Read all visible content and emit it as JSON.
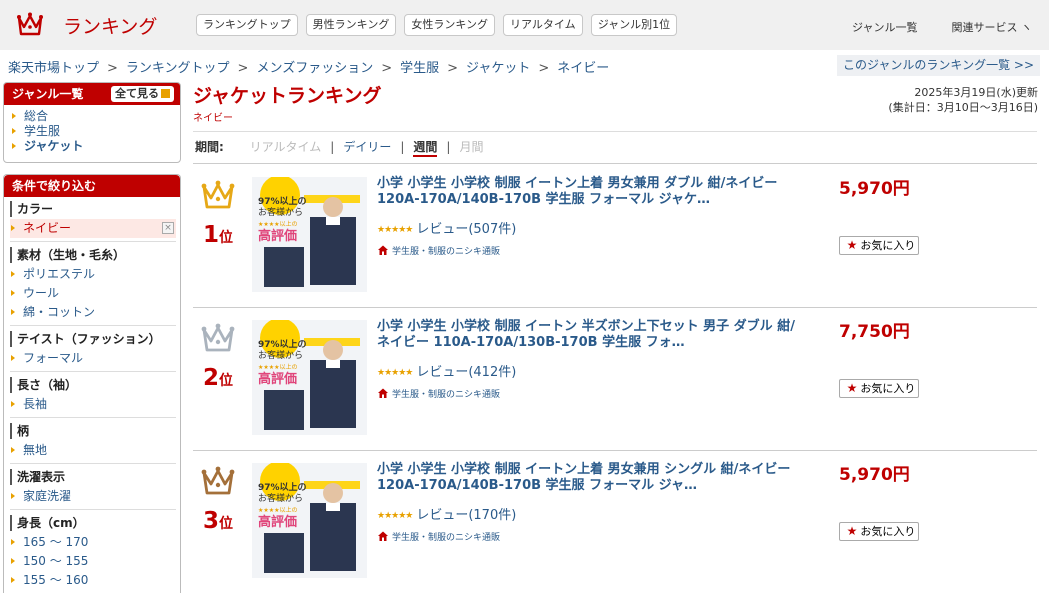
{
  "header": {
    "logo_text": "ランキング",
    "tabs": [
      "ランキングトップ",
      "男性ランキング",
      "女性ランキング",
      "リアルタイム",
      "ジャンル別1位"
    ],
    "genre_list": "ジャンル一覧",
    "related_services": "関連サービス ヽ"
  },
  "breadcrumb": [
    "楽天市場トップ",
    "ランキングトップ",
    "メンズファッション",
    "学生服",
    "ジャケット",
    "ネイビー"
  ],
  "breadcrumb_sep": ">",
  "genre_ranking_link": "このジャンルのランキング一覧 >>",
  "sidebar": {
    "genre_head": "ジャンル一覧",
    "all_view": "全て見る",
    "genres": [
      "総合",
      "学生服",
      "ジャケット"
    ],
    "filter_head": "条件で絞り込む",
    "clear": "×",
    "groups": [
      {
        "title": "カラー",
        "items": [
          "ネイビー"
        ]
      },
      {
        "title": "素材（生地・毛糸）",
        "items": [
          "ポリエステル",
          "ウール",
          "綿・コットン"
        ]
      },
      {
        "title": "テイスト（ファッション）",
        "items": [
          "フォーマル"
        ]
      },
      {
        "title": "長さ（袖）",
        "items": [
          "長袖"
        ]
      },
      {
        "title": "柄",
        "items": [
          "無地"
        ]
      },
      {
        "title": "洗濯表示",
        "items": [
          "家庭洗濯"
        ]
      },
      {
        "title": "身長（cm）",
        "items": [
          "165 ～ 170",
          "150 ～ 155",
          "155 ～ 160"
        ]
      }
    ]
  },
  "main": {
    "title": "ジャケットランキング",
    "subtitle": "ネイビー",
    "updated": "2025年3月19日(水)更新",
    "period_range": "(集計日：3月10日～3月16日)",
    "period_label": "期間:",
    "periods": [
      "リアルタイム",
      "デイリー",
      "週間",
      "月間"
    ],
    "period_sep": "|"
  },
  "items": [
    {
      "rank": "1",
      "rank_unit": "位",
      "title": "小学 小学生 小学校 制服 イートン上着 男女兼用 ダブル 紺/ネイビー 120A-170A/140B-170B 学生服 フォーマル ジャケ…",
      "stars": "★★★★★",
      "review": "レビュー(507件)",
      "shop": "学生服・制服のニシキ通販",
      "price": "5,970円",
      "fav": "お気に入り",
      "badge_lines": [
        "97%以上の",
        "お客様から",
        "★★★★以上の",
        "高評価"
      ],
      "crown_color": "#e6a817"
    },
    {
      "rank": "2",
      "rank_unit": "位",
      "title": "小学 小学生 小学校 制服 イートン 半ズボン上下セット 男子 ダブル 紺/ネイビー 110A-170A/130B-170B 学生服 フォ…",
      "stars": "★★★★★",
      "review": "レビュー(412件)",
      "shop": "学生服・制服のニシキ通販",
      "price": "7,750円",
      "fav": "お気に入り",
      "badge_lines": [
        "97%以上の",
        "お客様から",
        "★★★★以上の",
        "高評価"
      ],
      "crown_color": "#aab3bd"
    },
    {
      "rank": "3",
      "rank_unit": "位",
      "title": "小学 小学生 小学校 制服 イートン上着 男女兼用 シングル 紺/ネイビー 120A-170A/140B-170B 学生服 フォーマル ジャ…",
      "stars": "★★★★★",
      "review": "レビュー(170件)",
      "shop": "学生服・制服のニシキ通販",
      "price": "5,970円",
      "fav": "お気に入り",
      "badge_lines": [
        "97%以上の",
        "お客様から",
        "★★★★以上の",
        "高評価"
      ],
      "crown_color": "#a4703a"
    }
  ]
}
